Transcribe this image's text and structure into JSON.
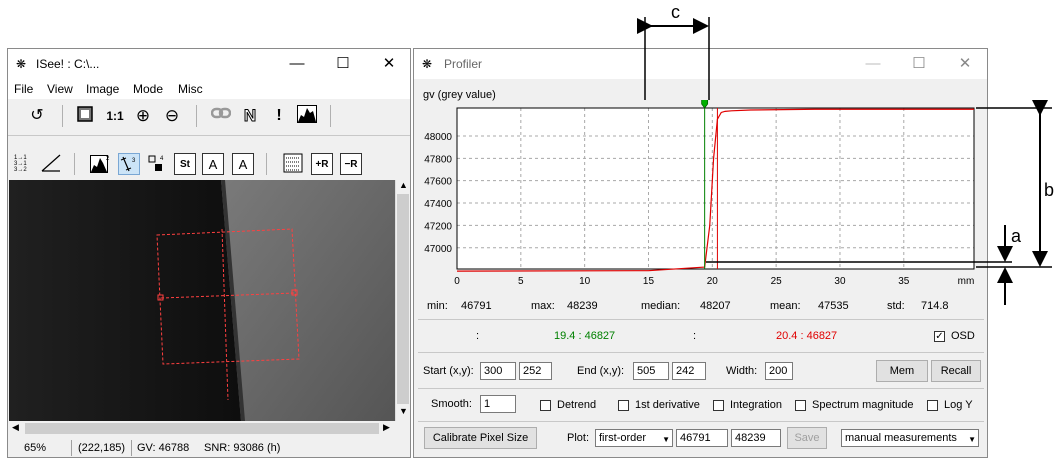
{
  "isee": {
    "title": "ISee! : C:\\...",
    "menu": [
      "File",
      "View",
      "Image",
      "Mode",
      "Misc"
    ],
    "toolbar_1to1": "1:1",
    "status": {
      "zoom": "65%",
      "coords": "(222,185)",
      "gv": "GV: 46788",
      "snr": "SNR: 93086 (h)"
    }
  },
  "profiler": {
    "title": "Profiler",
    "y_axis_label": "gv (grey value)",
    "stats": {
      "min_label": "min:",
      "min": "46791",
      "max_label": "max:",
      "max": "48239",
      "median_label": "median:",
      "median": "48207",
      "mean_label": "mean:",
      "mean": "47535",
      "std_label": "std:",
      "std": "714.8"
    },
    "cursor1": {
      "sep": ":",
      "value": "19.4 : 46827",
      "color": "#008000"
    },
    "cursor2": {
      "sep": ":",
      "value": "20.4 : 46827",
      "color": "#e00000"
    },
    "osd_label": "OSD",
    "start_label": "Start (x,y):",
    "start_x": "300",
    "start_y": "252",
    "end_label": "End (x,y):",
    "end_x": "505",
    "end_y": "242",
    "width_label": "Width:",
    "width": "200",
    "mem_button": "Mem",
    "recall_button": "Recall",
    "smooth_label": "Smooth:",
    "smooth": "1",
    "checkboxes": [
      "Detrend",
      "1st derivative",
      "Integration",
      "Spectrum magnitude",
      "Log Y"
    ],
    "calibrate_button": "Calibrate Pixel Size",
    "plot_label": "Plot:",
    "plot_value": "first-order",
    "plot_min": "46791",
    "plot_max": "48239",
    "save_button": "Save",
    "measure_mode": "manual measurements"
  },
  "annotations": {
    "a": "a",
    "b": "b",
    "c": "c"
  },
  "chart_data": {
    "type": "line",
    "ylabel": "gv (grey value)",
    "xunit": "mm",
    "xlim": [
      0,
      40.5
    ],
    "ylim": [
      46810,
      48250
    ],
    "xticks": [
      0,
      5,
      10,
      15,
      20,
      25,
      30,
      35
    ],
    "yticks": [
      47000,
      47200,
      47400,
      47600,
      47800,
      48000
    ],
    "grid": true,
    "series": [
      {
        "color": "#e00000",
        "x": [
          0,
          15,
          19.4,
          19.8,
          20.1,
          20.4,
          20.7,
          21.0,
          21.5,
          23,
          28,
          40.5
        ],
        "y": [
          46791,
          46795,
          46827,
          47200,
          47800,
          48150,
          48210,
          48220,
          48225,
          48232,
          48239,
          48239
        ]
      }
    ]
  }
}
